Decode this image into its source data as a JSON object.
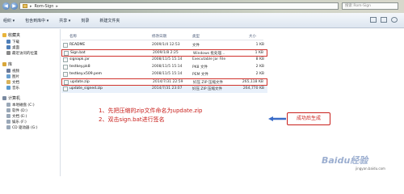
{
  "window": {
    "address_path": "Rom-Sign",
    "search_placeholder": "搜索 Rom-Sign"
  },
  "toolbar": {
    "items": [
      "组织 ▾",
      "包含到库中 ▾",
      "共享 ▾",
      "刻录",
      "新建文件夹"
    ]
  },
  "sidebar": {
    "items": [
      {
        "label": "收藏夹",
        "icon": "star-icon",
        "header": true,
        "color": "#e8b43a"
      },
      {
        "label": "下载",
        "icon": "download-folder-icon",
        "header": false,
        "color": "#4f7fb8"
      },
      {
        "label": "桌面",
        "icon": "desktop-icon",
        "header": false,
        "color": "#4f7fb8"
      },
      {
        "label": "最近访问的位置",
        "icon": "recent-places-icon",
        "header": false,
        "color": "#8a8a8a"
      },
      {
        "label": "库",
        "icon": "library-icon",
        "header": true,
        "color": "#d9a73a"
      },
      {
        "label": "视频",
        "icon": "video-library-icon",
        "header": false,
        "color": "#6a7a9a"
      },
      {
        "label": "图片",
        "icon": "pictures-library-icon",
        "header": false,
        "color": "#6aa0d0"
      },
      {
        "label": "文档",
        "icon": "documents-library-icon",
        "header": false,
        "color": "#d9b35a"
      },
      {
        "label": "音乐",
        "icon": "music-library-icon",
        "header": false,
        "color": "#5a9ad0"
      },
      {
        "label": "计算机",
        "icon": "computer-icon",
        "header": true,
        "color": "#7a8aa0"
      },
      {
        "label": "本地磁盘 (C:)",
        "icon": "drive-icon",
        "header": false,
        "color": "#9aa8b8"
      },
      {
        "label": "软件 (D:)",
        "icon": "drive-icon",
        "header": false,
        "color": "#9aa8b8"
      },
      {
        "label": "文档 (E:)",
        "icon": "drive-icon",
        "header": false,
        "color": "#9aa8b8"
      },
      {
        "label": "娱乐 (F:)",
        "icon": "drive-icon",
        "header": false,
        "color": "#9aa8b8"
      },
      {
        "label": "CD 驱动器 (G:)",
        "icon": "cd-drive-icon",
        "header": false,
        "color": "#9aa8b8"
      }
    ]
  },
  "columns": {
    "name": "名称",
    "date": "修改日期",
    "type": "类型",
    "size": "大小"
  },
  "files": [
    {
      "name": "README",
      "date": "2009/1/4 12:53",
      "type": "文件",
      "size": "1 KB",
      "highlight": false,
      "selected": false
    },
    {
      "name": "Sign.bat",
      "date": "2009/1/8 2:25",
      "type": "Windows 批处理...",
      "size": "1 KB",
      "highlight": true,
      "selected": false
    },
    {
      "name": "signapk.jar",
      "date": "2008/11/5 15:14",
      "type": "Executable Jar File",
      "size": "8 KB",
      "highlight": false,
      "selected": false
    },
    {
      "name": "testkey.pk8",
      "date": "2008/11/5 15:14",
      "type": "PK8 文件",
      "size": "2 KB",
      "highlight": false,
      "selected": false
    },
    {
      "name": "testkey.x509.pem",
      "date": "2008/11/5 15:14",
      "type": "PEM 文件",
      "size": "2 KB",
      "highlight": false,
      "selected": false
    },
    {
      "name": "update.zip",
      "date": "2014/7/31 22:59",
      "type": "好压 ZIP 压缩文件",
      "size": "265,118 KB",
      "highlight": true,
      "selected": false
    },
    {
      "name": "update_signed.zip",
      "date": "2014/7/31 23:07",
      "type": "好压 ZIP 压缩文件",
      "size": "264,770 KB",
      "highlight": false,
      "selected": true
    }
  ],
  "annotations": {
    "callout": "成功后生成",
    "step1": "1、先把压缩的zip文件命名为update.zip",
    "step2": "2、双击sign.bat进行签名",
    "color": "#c9201c"
  },
  "watermark": {
    "text": "Baidu经验",
    "sub": "jingyan.baidu.com"
  }
}
